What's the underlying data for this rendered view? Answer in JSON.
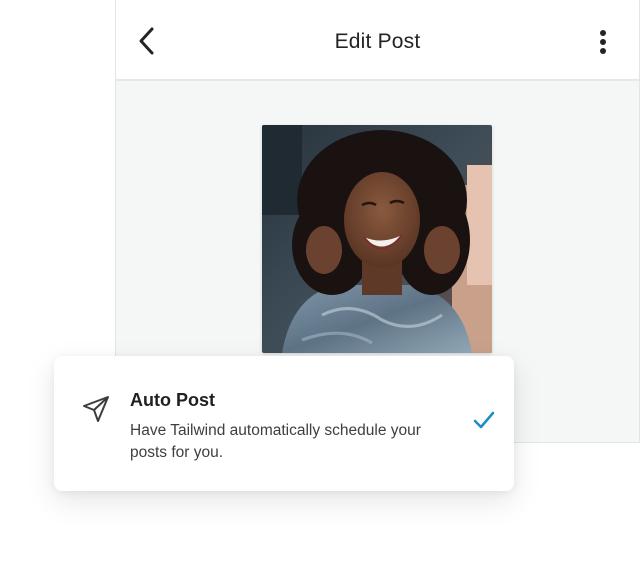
{
  "header": {
    "title": "Edit Post",
    "back_icon": "chevron-left-icon",
    "more_icon": "vertical-dots-icon"
  },
  "post": {
    "image_subject": "portrait-photo"
  },
  "auto_post": {
    "title": "Auto Post",
    "description": "Have Tailwind automatically schedule your posts for you.",
    "icon": "paper-plane-icon",
    "selected": true,
    "check_color": "#1a8cc6"
  }
}
